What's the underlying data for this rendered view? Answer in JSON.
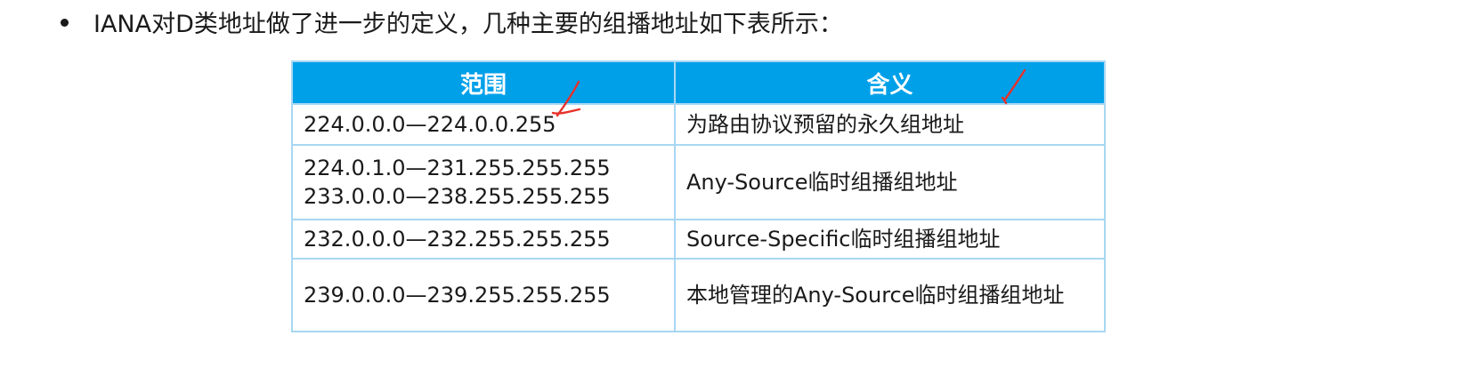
{
  "intro": {
    "bullet": "•",
    "text": "IANA对D类地址做了进一步的定义，几种主要的组播地址如下表所示："
  },
  "table": {
    "headers": {
      "range": "范围",
      "meaning": "含义"
    },
    "rows": [
      {
        "range_lines": [
          "224.0.0.0—224.0.0.255"
        ],
        "meaning": "为路由协议预留的永久组地址"
      },
      {
        "range_lines": [
          "224.0.1.0—231.255.255.255",
          "233.0.0.0—238.255.255.255"
        ],
        "meaning": "Any-Source临时组播组地址"
      },
      {
        "range_lines": [
          "232.0.0.0—232.255.255.255"
        ],
        "meaning": "Source-Specific临时组播组地址"
      },
      {
        "range_lines": [
          "239.0.0.0—239.255.255.255"
        ],
        "meaning": "本地管理的Any-Source临时组播组地址"
      }
    ]
  },
  "colors": {
    "header_bg": "#00a0e9",
    "border": "#a7d7f2",
    "annotation": "#e8312a"
  },
  "annotations": [
    {
      "name": "red-check-mark",
      "near": "range-row-1"
    },
    {
      "name": "red-check-mark",
      "near": "meaning-header"
    }
  ]
}
